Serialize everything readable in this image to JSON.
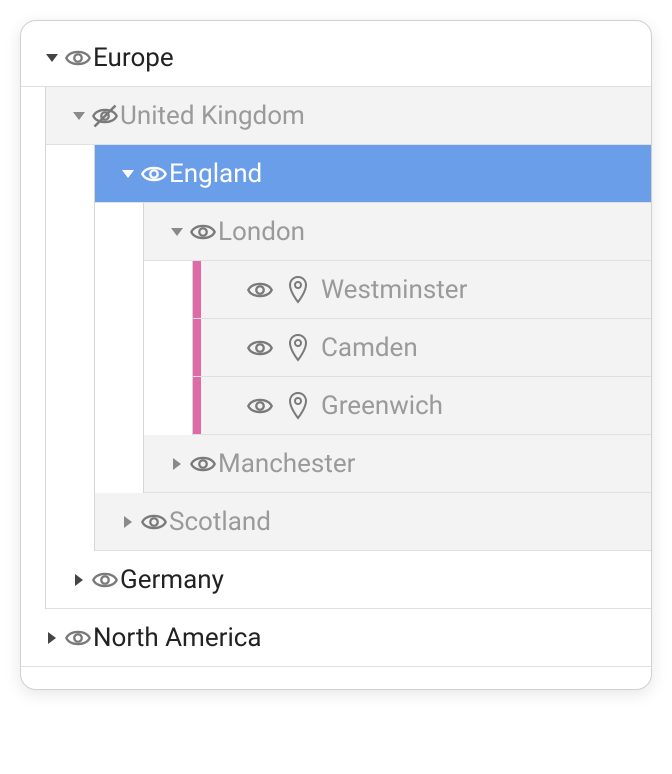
{
  "tree": {
    "europe": "Europe",
    "uk": "United Kingdom",
    "england": "England",
    "london": "London",
    "westminster": "Westminster",
    "camden": "Camden",
    "greenwich": "Greenwich",
    "manchester": "Manchester",
    "scotland": "Scotland",
    "germany": "Germany",
    "north_america": "North America"
  },
  "colors": {
    "selection": "#6b9ee8",
    "stripe": "#e06aa8",
    "dim_bg": "#f3f3f3"
  }
}
